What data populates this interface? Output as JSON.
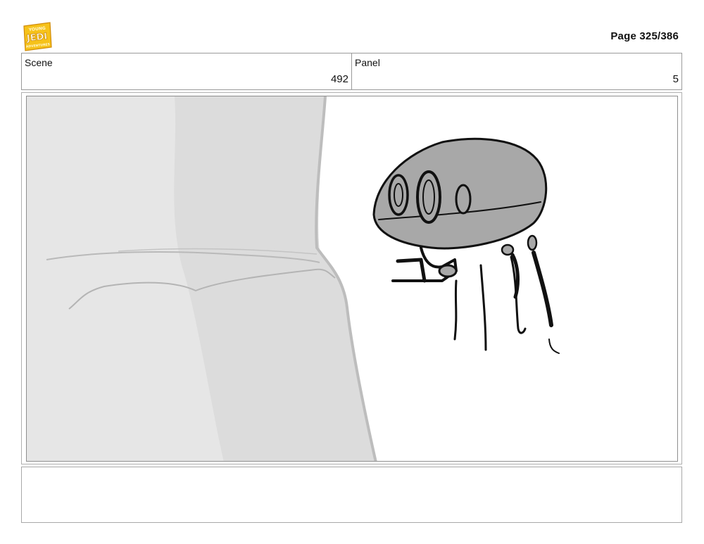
{
  "header": {
    "page_label": "Page 325/386"
  },
  "logo": {
    "text_lines": [
      "YOUNG",
      "JEDI",
      "ADVENTURES"
    ],
    "colors": {
      "fill": "#f6c21a",
      "outline": "#d08a08"
    }
  },
  "info_table": {
    "scene_label": "Scene",
    "scene_value": "492",
    "panel_label": "Panel",
    "panel_value": "5"
  },
  "notes": {
    "text": ""
  }
}
